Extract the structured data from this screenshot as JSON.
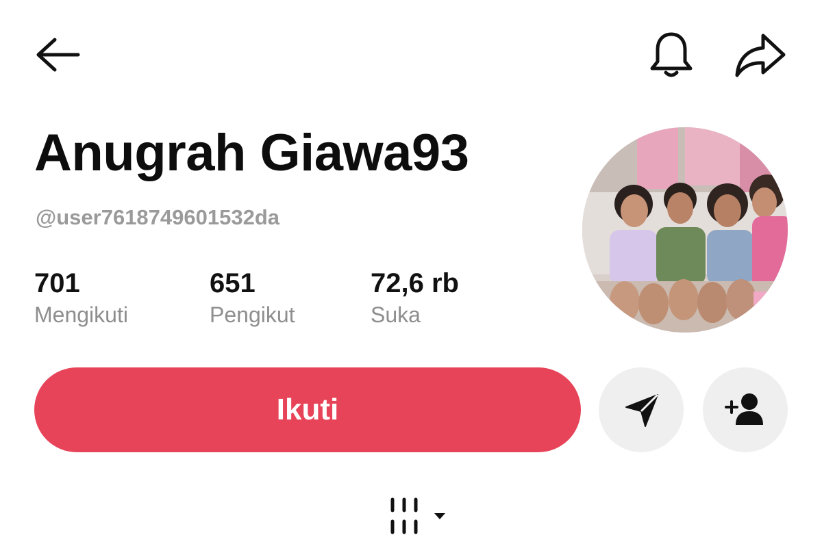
{
  "header": {
    "back_icon": "arrow-left-icon",
    "notification_icon": "bell-icon",
    "share_icon": "share-arrow-icon"
  },
  "profile": {
    "display_name": "Anugrah Giawa93",
    "username": "@user7618749601532da",
    "avatar": "profile-photo-group-of-children"
  },
  "stats": [
    {
      "value": "701",
      "label": "Mengikuti"
    },
    {
      "value": "651",
      "label": "Pengikut"
    },
    {
      "value": "72,6 rb",
      "label": "Suka"
    }
  ],
  "actions": {
    "follow_label": "Ikuti",
    "follow_color": "#e84459",
    "message_icon": "send-message-icon",
    "add_friend_icon": "add-friend-icon"
  },
  "tabs": {
    "grid_icon": "videos-grid-icon",
    "dropdown_icon": "caret-down-icon"
  }
}
